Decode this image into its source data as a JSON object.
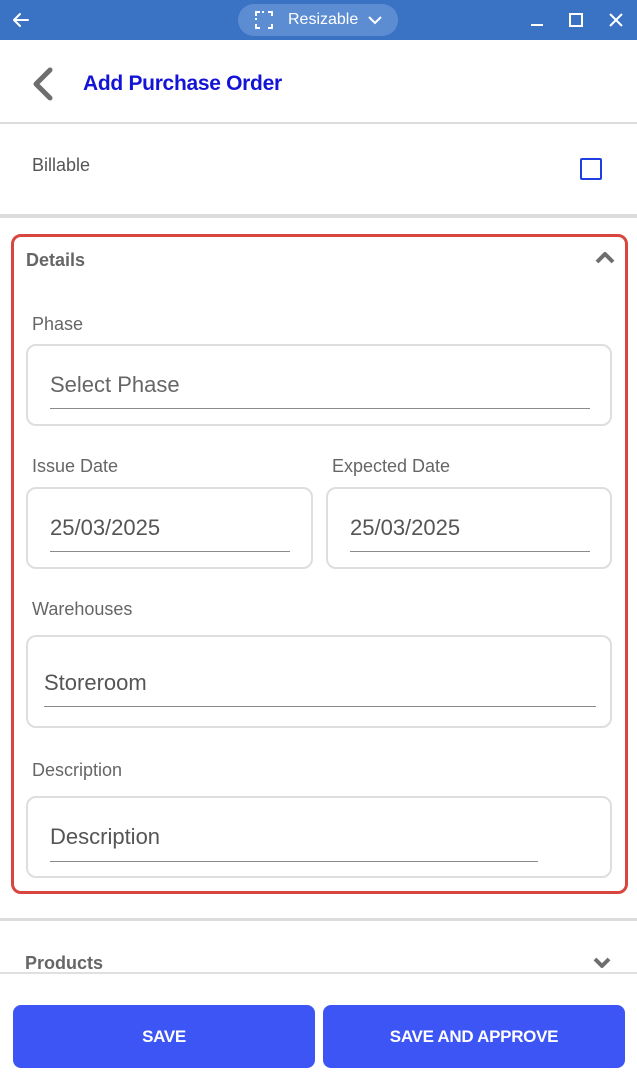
{
  "window": {
    "mode_label": "Resizable"
  },
  "header": {
    "title": "Add Purchase Order"
  },
  "billable": {
    "label": "Billable",
    "checked": false
  },
  "details": {
    "title": "Details",
    "phase": {
      "label": "Phase",
      "placeholder": "Select Phase"
    },
    "issue_date": {
      "label": "Issue Date",
      "value": "25/03/2025"
    },
    "expected_date": {
      "label": "Expected Date",
      "value": "25/03/2025"
    },
    "warehouses": {
      "label": "Warehouses",
      "value": "Storeroom"
    },
    "description": {
      "label": "Description",
      "placeholder": "Description"
    }
  },
  "products": {
    "title": "Products"
  },
  "actions": {
    "save_label": "SAVE",
    "save_approve_label": "SAVE AND APPROVE"
  },
  "colors": {
    "chrome": "#3b73c4",
    "title": "#1414d6",
    "accent": "#3d55f5",
    "highlight": "#d9453f"
  },
  "icons": [
    "back-arrow-icon",
    "resize-icon",
    "chevron-down-icon",
    "minimize-icon",
    "maximize-icon",
    "close-icon",
    "chevron-left-icon",
    "chevron-up-icon"
  ]
}
